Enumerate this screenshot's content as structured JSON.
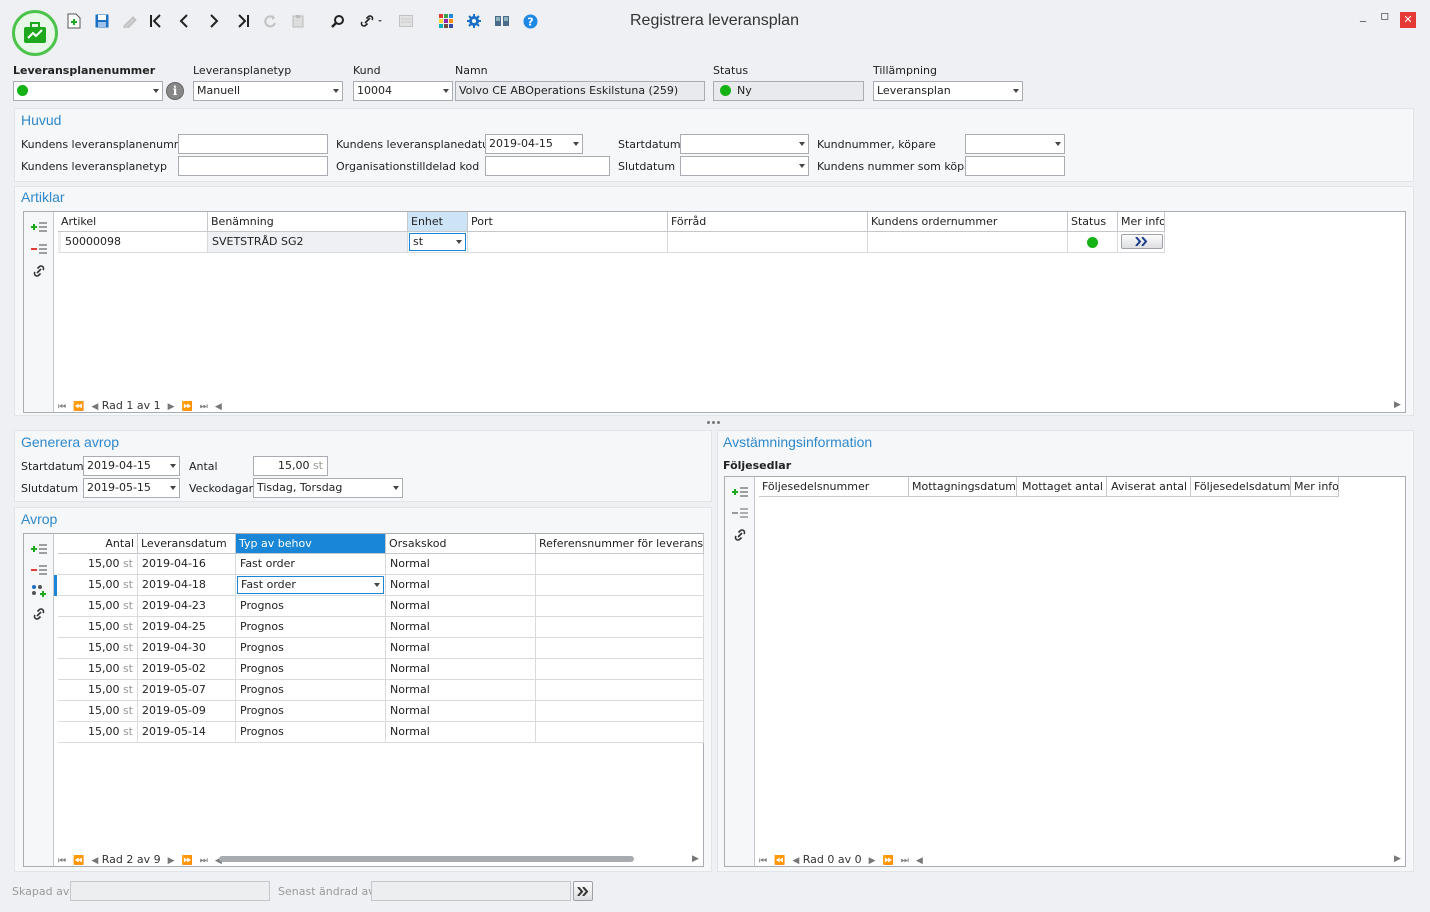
{
  "window": {
    "title": "Registrera leveransplan",
    "minimize_label": "_",
    "maximize_label": "▫",
    "close_label": "✕"
  },
  "toolbar": {
    "icons": [
      "new-document-icon",
      "save-icon",
      "edit-icon",
      "first-record-icon",
      "previous-record-icon",
      "next-record-icon",
      "last-record-icon",
      "refresh-icon",
      "paste-icon",
      "search-icon",
      "link-icon",
      "window-icon",
      "apps-grid-icon",
      "settings-icon",
      "book-icon",
      "help-icon"
    ]
  },
  "header": {
    "plan_number_label": "Leveransplanenummer",
    "plan_type_label": "Leveransplanetyp",
    "plan_type_value": "Manuell",
    "customer_label": "Kund",
    "customer_value": "10004",
    "name_label": "Namn",
    "name_value": "Volvo CE ABOperations Eskilstuna (259)",
    "status_label": "Status",
    "status_value": "Ny",
    "application_label": "Tillämpning",
    "application_value": "Leveransplan"
  },
  "huvud": {
    "title": "Huvud",
    "cust_plan_number_label": "Kundens leveransplanenummer",
    "cust_plan_number_value": "",
    "cust_plan_date_label": "Kundens leveransplanedatum",
    "cust_plan_date_value": "2019-04-15",
    "start_date_label": "Startdatum",
    "start_date_value": "",
    "buyer_number_label": "Kundnummer, köpare",
    "buyer_number_value": "",
    "cust_plan_type_label": "Kundens leveransplanetyp",
    "cust_plan_type_value": "",
    "org_code_label": "Organisationstilldelad kod",
    "org_code_value": "",
    "end_date_label": "Slutdatum",
    "end_date_value": "",
    "cust_number_buyer_label": "Kundens nummer som köpare",
    "cust_number_buyer_value": ""
  },
  "artiklar": {
    "title": "Artiklar",
    "columns": [
      "Artikel",
      "Benämning",
      "Enhet",
      "Port",
      "Förråd",
      "Kundens ordernummer",
      "Status",
      "Mer info"
    ],
    "rows": [
      {
        "artikel": "50000098",
        "benamning": "SVETSTRÅD SG2",
        "enhet": "st",
        "port": "",
        "forrad": "",
        "ordernr": ""
      }
    ],
    "pager": "Rad 1 av 1"
  },
  "generera": {
    "title": "Generera avrop",
    "start_label": "Startdatum",
    "start_value": "2019-04-15",
    "end_label": "Slutdatum",
    "end_value": "2019-05-15",
    "qty_label": "Antal",
    "qty_value": "15,00",
    "qty_unit": "st",
    "weekdays_label": "Veckodagar",
    "weekdays_value": "Tisdag, Torsdag"
  },
  "avrop": {
    "title": "Avrop",
    "columns": [
      "Antal",
      "Leveransdatum",
      "Typ av behov",
      "Orsakskod",
      "Referensnummer för leverans"
    ],
    "rows": [
      {
        "antal": "15,00",
        "unit": "st",
        "datum": "2019-04-16",
        "typ": "Fast order",
        "orsak": "Normal",
        "ref": ""
      },
      {
        "antal": "15,00",
        "unit": "st",
        "datum": "2019-04-18",
        "typ": "Fast order",
        "orsak": "Normal",
        "ref": ""
      },
      {
        "antal": "15,00",
        "unit": "st",
        "datum": "2019-04-23",
        "typ": "Prognos",
        "orsak": "Normal",
        "ref": ""
      },
      {
        "antal": "15,00",
        "unit": "st",
        "datum": "2019-04-25",
        "typ": "Prognos",
        "orsak": "Normal",
        "ref": ""
      },
      {
        "antal": "15,00",
        "unit": "st",
        "datum": "2019-04-30",
        "typ": "Prognos",
        "orsak": "Normal",
        "ref": ""
      },
      {
        "antal": "15,00",
        "unit": "st",
        "datum": "2019-05-02",
        "typ": "Prognos",
        "orsak": "Normal",
        "ref": ""
      },
      {
        "antal": "15,00",
        "unit": "st",
        "datum": "2019-05-07",
        "typ": "Prognos",
        "orsak": "Normal",
        "ref": ""
      },
      {
        "antal": "15,00",
        "unit": "st",
        "datum": "2019-05-09",
        "typ": "Prognos",
        "orsak": "Normal",
        "ref": ""
      },
      {
        "antal": "15,00",
        "unit": "st",
        "datum": "2019-05-14",
        "typ": "Prognos",
        "orsak": "Normal",
        "ref": ""
      }
    ],
    "pager": "Rad 2 av 9"
  },
  "avstamning": {
    "title": "Avstämningsinformation",
    "subtitle": "Följesedlar",
    "columns": [
      "Följesedelsnummer",
      "Mottagningsdatum",
      "Mottaget antal",
      "Aviserat antal",
      "Följesedelsdatum",
      "Mer info"
    ],
    "pager": "Rad 0 av 0"
  },
  "footer": {
    "created_label": "Skapad av",
    "created_value": "",
    "changed_label": "Senast ändrad av",
    "changed_value": ""
  },
  "colors": {
    "accent": "#2e88cc",
    "status_green": "#14b214",
    "selection": "#1a86d7"
  }
}
